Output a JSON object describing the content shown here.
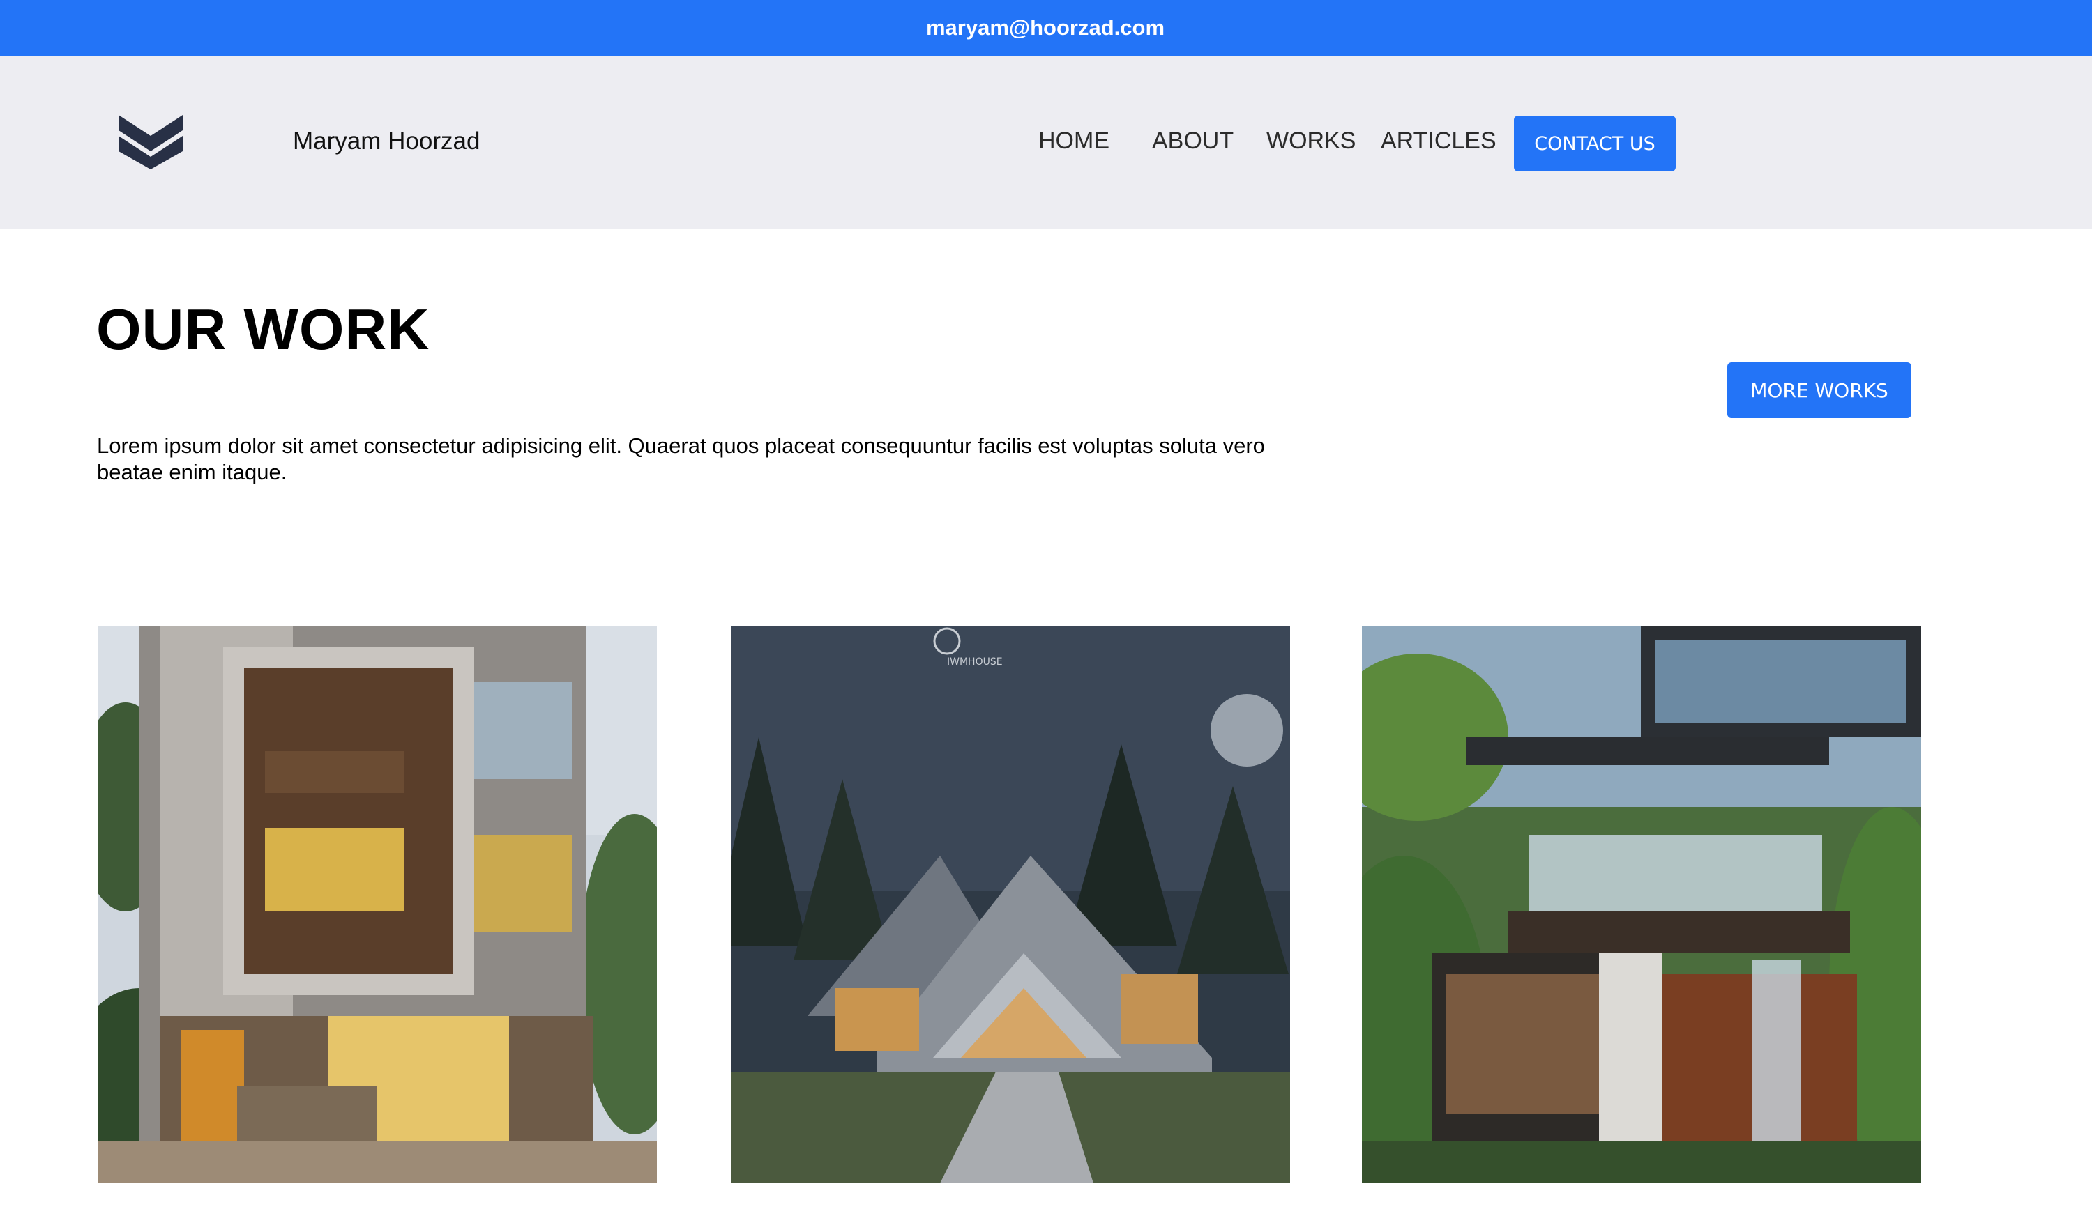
{
  "topbar": {
    "email": "maryam@hoorzad.com"
  },
  "header": {
    "logo_icon": "m-chevron-logo-icon",
    "brand_name": "Maryam Hoorzad",
    "nav": [
      "HOME",
      "ABOUT",
      "WORKS",
      "ARTICLES"
    ],
    "contact_label": "CONTACT US"
  },
  "works": {
    "title": "OUR WORK",
    "more_label": "MORE WORKS",
    "intro": "Lorem ipsum dolor sit amet consectetur adipisicing elit. Quaerat quos placeat consequuntur facilis est voluptas soluta vero beatae enim itaque.",
    "projects": [
      {
        "image": "modern-wood-facade-house-photo"
      },
      {
        "image": "angular-forest-house-night-photo",
        "watermark": "IWMHOUSE"
      },
      {
        "image": "tropical-glass-house-waterfall-photo"
      }
    ]
  },
  "colors": {
    "accent": "#2374f7",
    "header_bg": "#ededf2",
    "page_bg": "#ffffff"
  }
}
